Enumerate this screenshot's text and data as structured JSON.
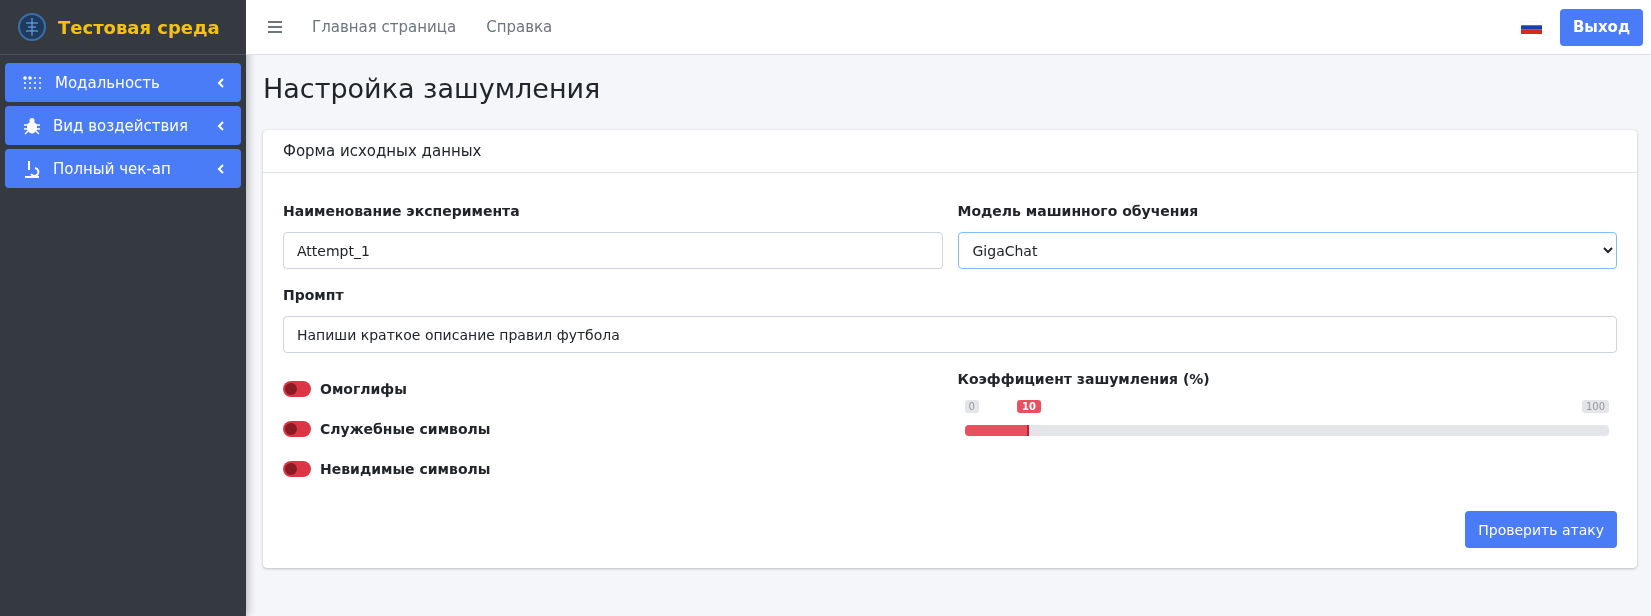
{
  "brand": {
    "title": "Тестовая среда"
  },
  "sidebar": {
    "items": [
      {
        "label": "Модальность",
        "expanded": false
      },
      {
        "label": "Вид воздействия",
        "expanded": false
      },
      {
        "label": "Полный чек-ап",
        "expanded": false
      }
    ]
  },
  "navbar": {
    "links": [
      "Главная страница",
      "Справка"
    ],
    "logout": "Выход"
  },
  "page_title": "Настройка зашумления",
  "card": {
    "header": "Форма исходных данных",
    "experiment": {
      "label": "Наименование эксперимента",
      "value": "Attempt_1"
    },
    "model": {
      "label": "Модель машинного обучения",
      "value": "GigaChat"
    },
    "prompt": {
      "label": "Промпт",
      "value": "Напиши краткое описание правил футбола"
    },
    "toggles": [
      {
        "label": "Омоглифы",
        "on": false
      },
      {
        "label": "Служебные символы",
        "on": false
      },
      {
        "label": "Невидимые символы",
        "on": false
      }
    ],
    "slider": {
      "label": "Коэффициент зашумления (%)",
      "min": "0",
      "max": "100",
      "value": "10",
      "level": 0.1
    },
    "submit": "Проверить атаку"
  }
}
